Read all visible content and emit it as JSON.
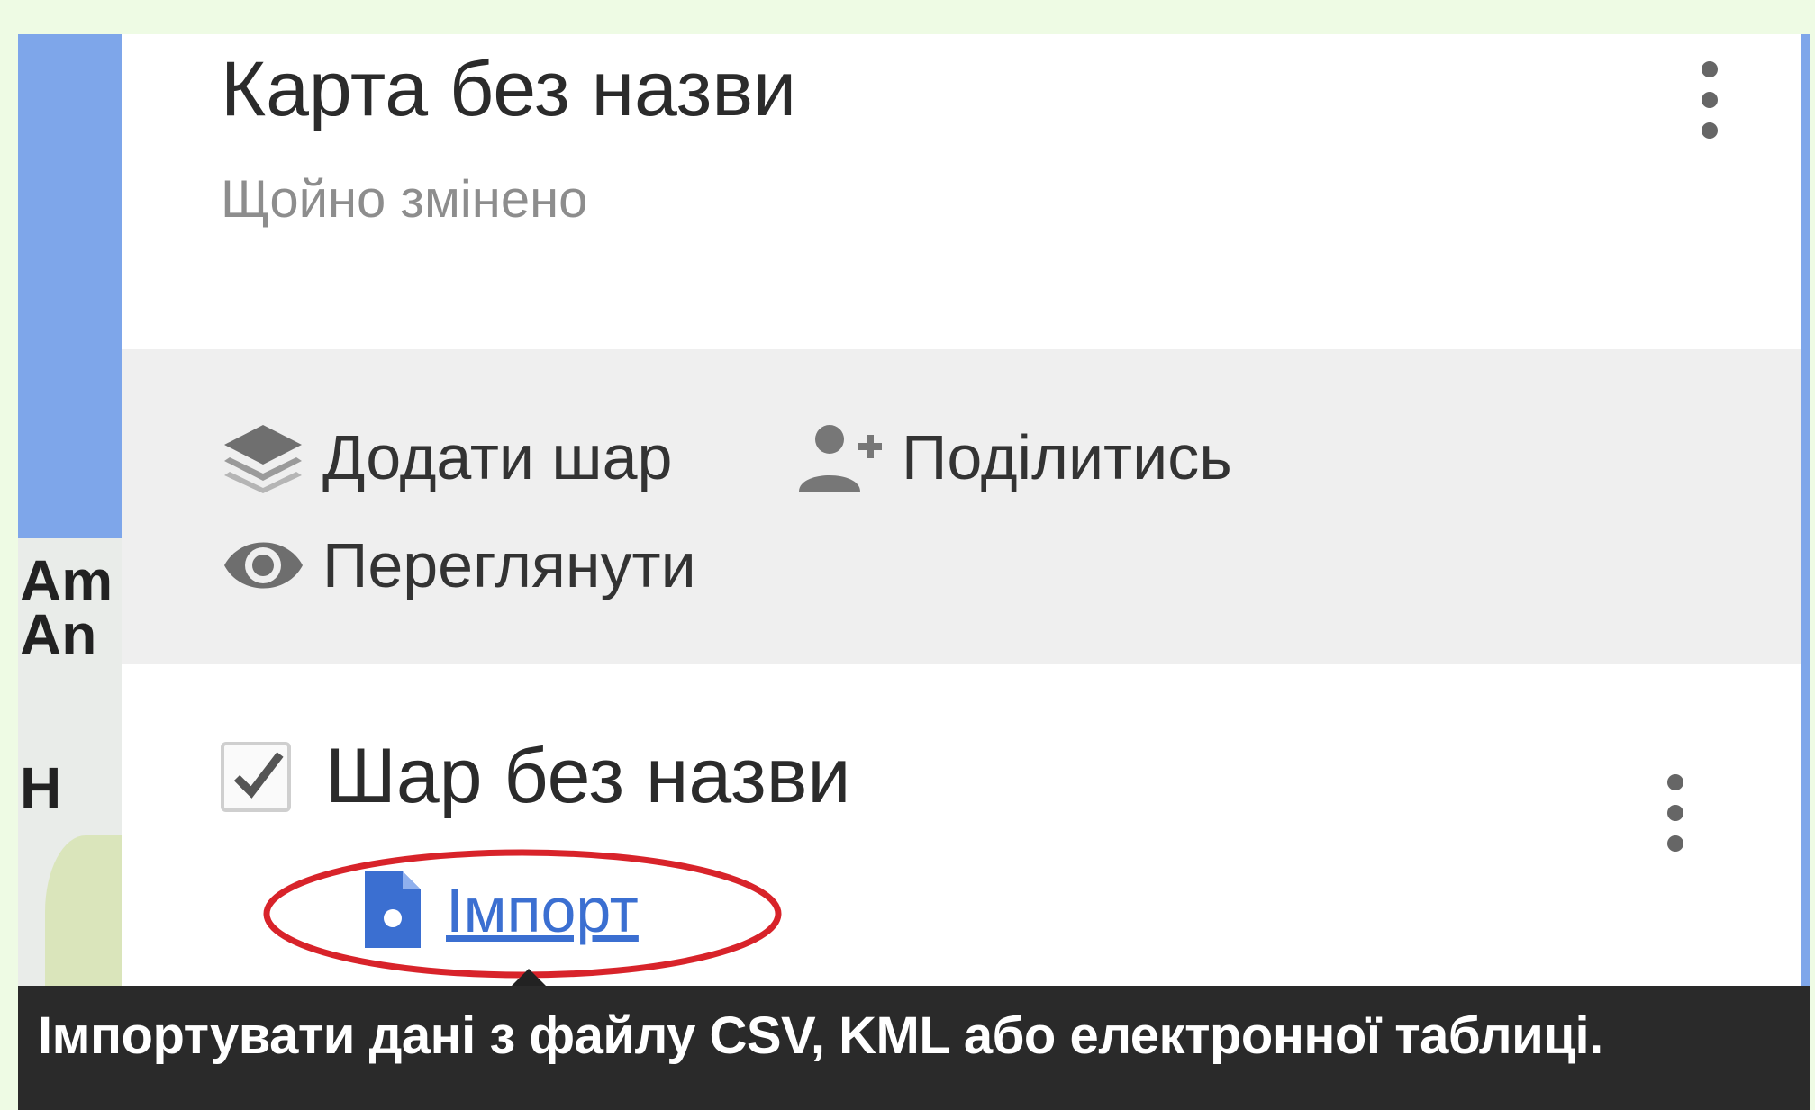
{
  "map": {
    "label_line1": "Am",
    "label_line2": "An",
    "label_line3": "H"
  },
  "panel": {
    "title": "Карта без назви",
    "subtitle": "Щойно змінено",
    "actions": {
      "add_layer": {
        "label": "Додати шар",
        "icon": "layers-icon"
      },
      "share": {
        "label": "Поділитись",
        "icon": "person-add-icon"
      },
      "preview": {
        "label": "Переглянути",
        "icon": "eye-icon"
      }
    },
    "layer": {
      "title": "Шар без назви",
      "checked": true,
      "import_label": "Імпорт",
      "import_icon": "file-import-icon"
    }
  },
  "tooltip": {
    "text": "Імпортувати дані з файлу CSV, KML або електронної таблиці."
  },
  "colors": {
    "link": "#3b6fd1",
    "highlight": "#d8232a",
    "tooltip_bg": "#2a2a2a",
    "outer_bg": "#eefbe4"
  }
}
